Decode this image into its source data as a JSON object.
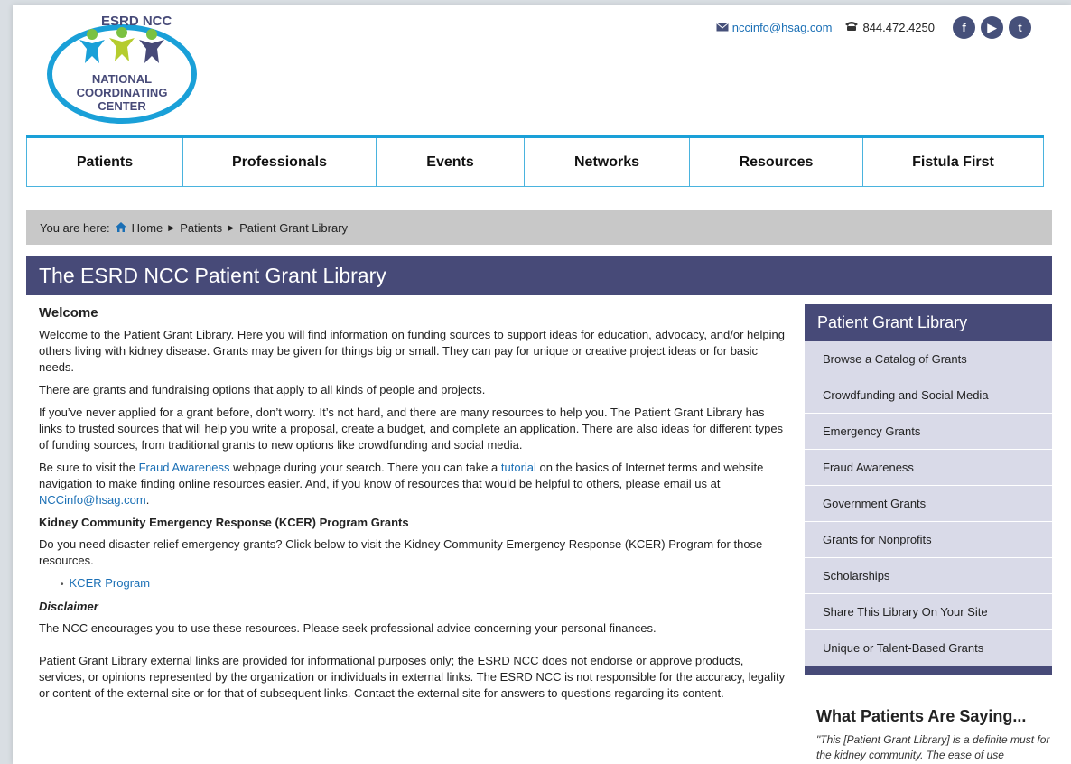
{
  "logo": {
    "line1": "ESRD NCC",
    "line2": "NATIONAL",
    "line3": "COORDINATING",
    "line4": "CENTER"
  },
  "contact": {
    "email": "nccinfo@hsag.com",
    "phone": "844.472.4250",
    "social": [
      {
        "icon": "facebook-icon",
        "glyph": "f"
      },
      {
        "icon": "youtube-icon",
        "glyph": "▶"
      },
      {
        "icon": "twitter-icon",
        "glyph": "t"
      }
    ]
  },
  "nav": [
    "Patients",
    "Professionals",
    "Events",
    "Networks",
    "Resources",
    "Fistula First"
  ],
  "breadcrumb": {
    "prefix": "You are here:",
    "home": "Home",
    "level1": "Patients",
    "current": "Patient Grant Library"
  },
  "page_title": "The ESRD NCC Patient Grant Library",
  "content": {
    "welcome_heading": "Welcome",
    "p1": "Welcome to the Patient Grant Library. Here you will find information on funding sources to support ideas for education, advocacy, and/or helping others living with kidney disease. Grants may be given for things big or small. They can pay for unique or creative project ideas or for basic needs.",
    "p2": "There are grants and fundraising options that apply to all kinds of people and projects.",
    "p3": "If you’ve never applied for a grant before, don’t worry. It’s not hard, and there are many resources to help you. The Patient Grant Library has links to trusted sources that will help you write a proposal, create a budget, and complete an application. There are also ideas for different types of funding sources, from traditional grants to new options like crowdfunding and social media.",
    "p4_a": "Be sure to visit the ",
    "p4_link1": "Fraud Awareness",
    "p4_b": " webpage during your search. There you can take a ",
    "p4_link2": "tutorial",
    "p4_c": " on the basics of Internet terms and website navigation to make finding online resources easier.  And, if you know of resources that would be helpful to others, please email us at ",
    "p4_link3": "NCCinfo@hsag.com",
    "p4_d": ".",
    "kcer_heading": "Kidney Community Emergency Response (KCER) Program Grants",
    "kcer_p": "Do you need disaster relief emergency grants? Click below to visit the Kidney Community Emergency Response (KCER) Program for those resources.",
    "kcer_link": "KCER Program",
    "disclaimer_heading": "Disclaimer",
    "disclaimer_p1": "The NCC encourages you to use these resources. Please seek professional advice concerning your personal finances.",
    "disclaimer_p2": "Patient Grant Library external links are provided for informational purposes only; the ESRD NCC does not endorse or approve products, services, or opinions represented by the organization or individuals in external links. The ESRD NCC is not responsible for the accuracy, legality or content of the external site or for that of subsequent links. Contact the external site for answers to questions regarding its content."
  },
  "sidebar": {
    "title": "Patient Grant Library",
    "items": [
      "Browse a Catalog of Grants",
      "Crowdfunding and Social Media",
      "Emergency Grants",
      "Fraud Awareness",
      "Government Grants",
      "Grants for Nonprofits",
      "Scholarships",
      "Share This Library On Your Site",
      "Unique or Talent-Based Grants"
    ]
  },
  "testimonial": {
    "title": "What Patients Are Saying...",
    "quote": "\"This [Patient Grant Library] is a definite must for the kidney community. The ease of use"
  },
  "colors": {
    "accent_blue": "#1aa0d8",
    "title_bar": "#474a78",
    "sidebar_bg": "#d9dae8",
    "link": "#1a6fb5"
  }
}
